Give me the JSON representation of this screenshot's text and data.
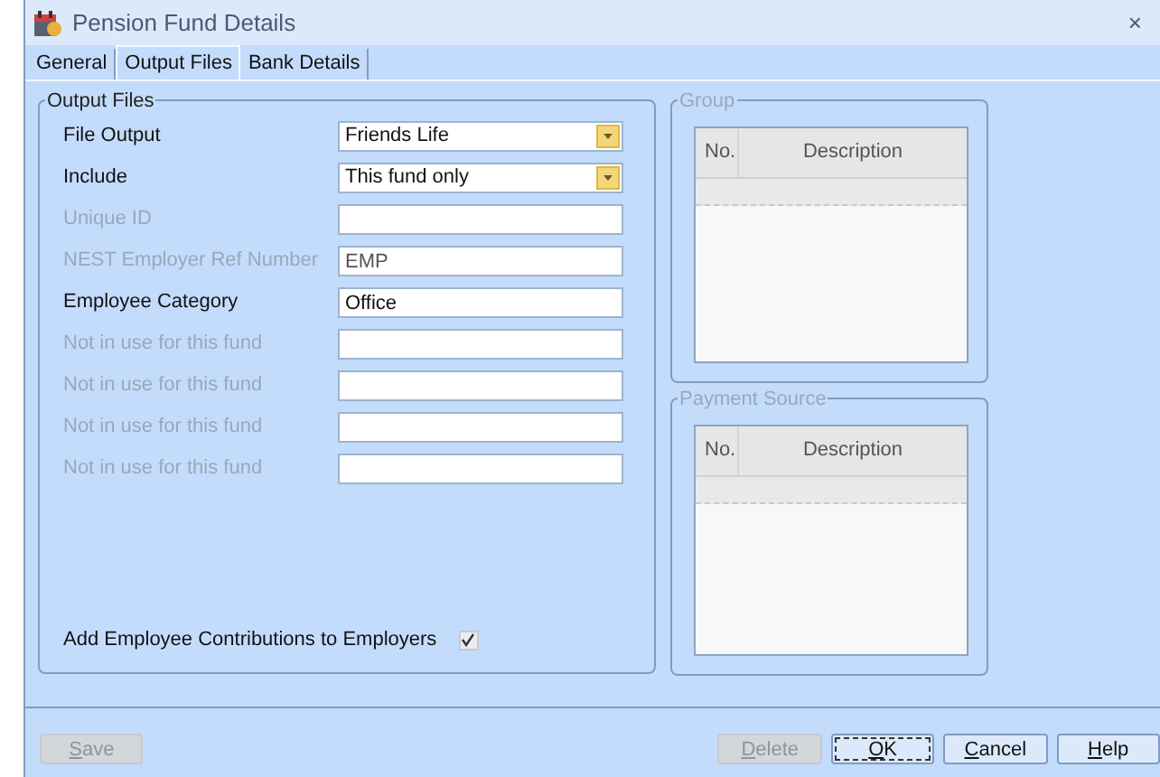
{
  "window": {
    "title": "Pension Fund Details",
    "close": "×"
  },
  "tabs": [
    {
      "label": "General",
      "selected": false
    },
    {
      "label": "Output Files",
      "selected": true
    },
    {
      "label": "Bank Details",
      "selected": false
    }
  ],
  "output_files": {
    "title": "Output Files",
    "fields": [
      {
        "kind": "dropdown",
        "label": "File Output",
        "value": "Friends Life",
        "disabled": false
      },
      {
        "kind": "dropdown",
        "label": "Include",
        "value": "This fund only",
        "disabled": false
      },
      {
        "kind": "text",
        "label": "Unique ID",
        "disabled": true
      },
      {
        "kind": "text",
        "label": "NEST Employer Ref Number",
        "value": "EMP",
        "disabled": true
      },
      {
        "kind": "text",
        "label": "Employee Category",
        "value": "Office",
        "disabled": false
      },
      {
        "kind": "text",
        "label": "Not in use for this fund",
        "disabled": true
      },
      {
        "kind": "text",
        "label": "Not in use for this fund",
        "disabled": true
      },
      {
        "kind": "text",
        "label": "Not in use for this fund",
        "disabled": true
      },
      {
        "kind": "text",
        "label": "Not in use for this fund",
        "disabled": true
      }
    ],
    "checkbox": {
      "label": "Add Employee Contributions to Employers",
      "checked": true
    }
  },
  "group": {
    "title": "Group",
    "columns": [
      "No.",
      "Description"
    ]
  },
  "payment_source": {
    "title": "Payment Source",
    "columns": [
      "No.",
      "Description"
    ]
  },
  "buttons": [
    {
      "key": "S",
      "rest": "ave",
      "disabled": true,
      "focused": false
    },
    {
      "key": "D",
      "rest": "elete",
      "disabled": true,
      "focused": false
    },
    {
      "key": "O",
      "rest": "K",
      "disabled": false,
      "focused": true
    },
    {
      "key": "C",
      "rest": "ancel",
      "disabled": false,
      "focused": false
    },
    {
      "key": "H",
      "rest": "elp",
      "disabled": false,
      "focused": false
    }
  ]
}
